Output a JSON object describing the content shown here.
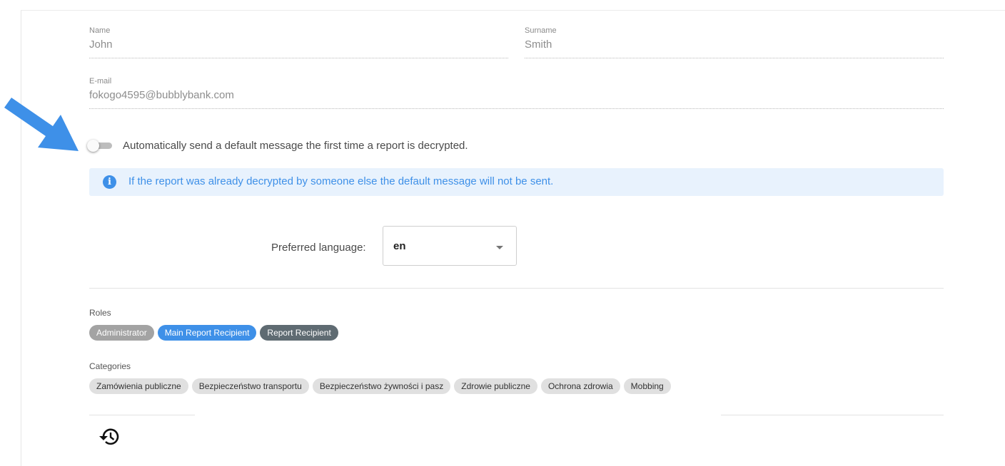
{
  "profile": {
    "name_label": "Name",
    "name_value": "John",
    "surname_label": "Surname",
    "surname_value": "Smith",
    "email_label": "E-mail",
    "email_value": "fokogo4595@bubblybank.com"
  },
  "auto_message": {
    "enabled": false,
    "label": "Automatically send a default message the first time a report is decrypted."
  },
  "info": {
    "icon": "info-icon",
    "text": "If the report was already decrypted by someone else the default message will not be sent."
  },
  "language": {
    "label": "Preferred language:",
    "selected": "en"
  },
  "roles": {
    "label": "Roles",
    "items": [
      {
        "label": "Administrator",
        "active": false
      },
      {
        "label": "Main Report Recipient",
        "active": true
      },
      {
        "label": "Report Recipient",
        "active": true
      }
    ]
  },
  "categories": {
    "label": "Categories",
    "items": [
      "Zamówienia publiczne",
      "Bezpieczeństwo transportu",
      "Bezpieczeństwo żywności i pasz",
      "Zdrowie publiczne",
      "Ochrona zdrowia",
      "Mobbing"
    ]
  },
  "icons": {
    "arrow": "arrow-pointer-icon",
    "history": "history-icon"
  },
  "colors": {
    "accent": "#3e90e8",
    "info_bg": "#e8f2fd",
    "role_inactive": "#a3a3a3",
    "role_recipient": "#5f6b72",
    "chip_bg": "#e0e0e0"
  }
}
